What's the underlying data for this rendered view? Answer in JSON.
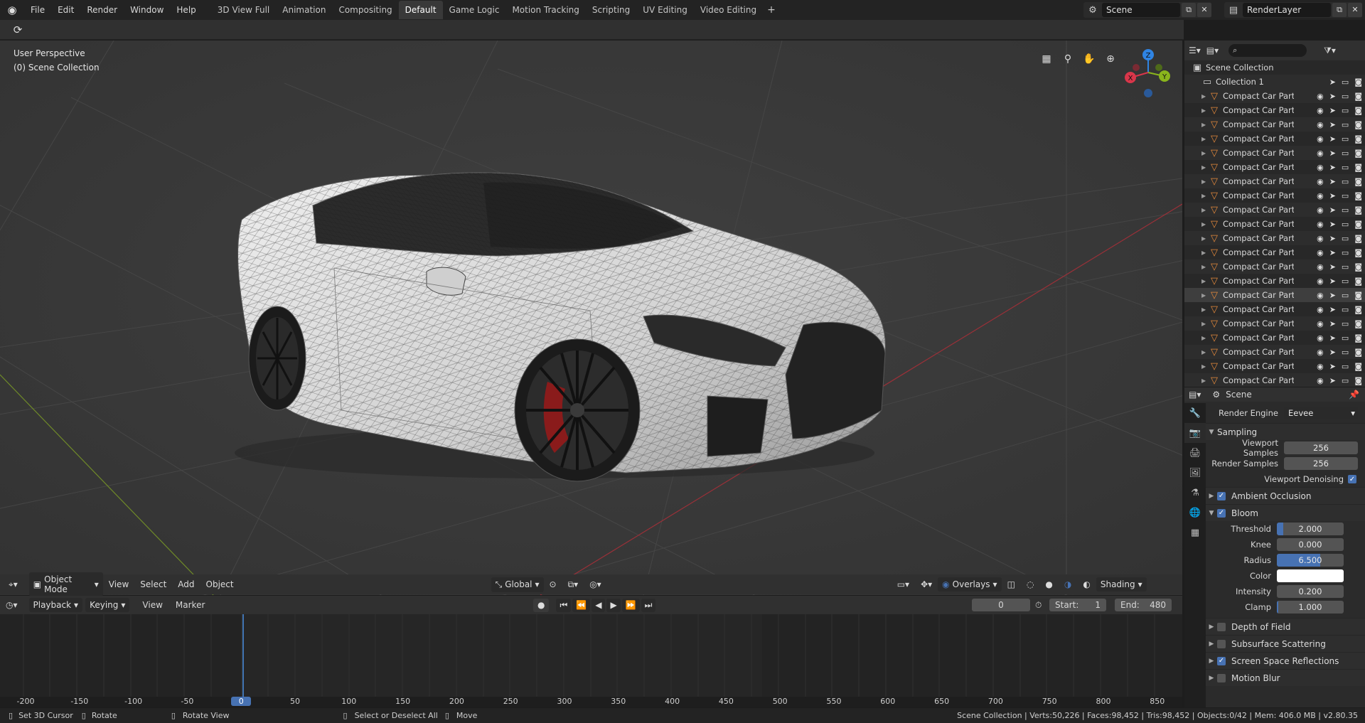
{
  "menus": [
    "File",
    "Edit",
    "Render",
    "Window",
    "Help"
  ],
  "workspaces": [
    "3D View Full",
    "Animation",
    "Compositing",
    "Default",
    "Game Logic",
    "Motion Tracking",
    "Scripting",
    "UV Editing",
    "Video Editing"
  ],
  "active_workspace": "Default",
  "scene_name": "Scene",
  "view_layer": "RenderLayer",
  "viewport": {
    "perspective": "User Perspective",
    "collection": "(0) Scene Collection",
    "mode": "Object Mode",
    "menus": [
      "View",
      "Select",
      "Add",
      "Object"
    ],
    "orientation": "Global",
    "overlays": "Overlays",
    "shading": "Shading",
    "gizmo": {
      "x": "X",
      "y": "Y",
      "z": "Z"
    }
  },
  "timeline": {
    "menus": [
      "Playback",
      "Keying",
      "View",
      "Marker"
    ],
    "current_frame": "0",
    "start_label": "Start:",
    "start": "1",
    "end_label": "End:",
    "end": "480",
    "ruler": [
      "-200",
      "-150",
      "-100",
      "-50",
      "0",
      "50",
      "100",
      "150",
      "200",
      "250",
      "300",
      "350",
      "400",
      "450",
      "500",
      "550",
      "600",
      "650",
      "700",
      "750",
      "800",
      "850"
    ]
  },
  "outliner": {
    "root": "Scene Collection",
    "collection": "Collection 1",
    "items": [
      "Compact Car Part.0",
      "Compact Car Part.0",
      "Compact Car Part.0",
      "Compact Car Part.0",
      "Compact Car Part.0",
      "Compact Car Part.0",
      "Compact Car Part.0",
      "Compact Car Part.0",
      "Compact Car Part.0",
      "Compact Car Part.0",
      "Compact Car Part.0",
      "Compact Car Part.0",
      "Compact Car Part.0",
      "Compact Car Part.0",
      "Compact Car Part.0",
      "Compact Car Part.0",
      "Compact Car Part.0",
      "Compact Car Part.0",
      "Compact Car Part.0",
      "Compact Car Part.0",
      "Compact Car Part.0"
    ],
    "selected_index": 14
  },
  "properties": {
    "title": "Scene",
    "render_engine_label": "Render Engine",
    "render_engine": "Eevee",
    "sampling": "Sampling",
    "viewport_samples_label": "Viewport Samples",
    "viewport_samples": "256",
    "render_samples_label": "Render Samples",
    "render_samples": "256",
    "viewport_denoising": "Viewport Denoising",
    "ambient_occlusion": "Ambient Occlusion",
    "bloom": "Bloom",
    "threshold_label": "Threshold",
    "threshold": "2.000",
    "threshold_fill": 0.1,
    "knee_label": "Knee",
    "knee": "0.000",
    "knee_fill": 0,
    "radius_label": "Radius",
    "radius": "6.500",
    "radius_fill": 0.65,
    "color_label": "Color",
    "intensity_label": "Intensity",
    "intensity": "0.200",
    "intensity_fill": 0,
    "clamp_label": "Clamp",
    "clamp": "1.000",
    "clamp_fill": 0.02,
    "depth_of_field": "Depth of Field",
    "subsurface": "Subsurface Scattering",
    "ssr": "Screen Space Reflections",
    "motion_blur": "Motion Blur"
  },
  "status": {
    "set_cursor": "Set 3D Cursor",
    "rotate": "Rotate",
    "rotate_view": "Rotate View",
    "select": "Select or Deselect All",
    "move": "Move",
    "stats": "Scene Collection | Verts:50,226 | Faces:98,452 | Tris:98,452 | Objects:0/42 | Mem: 406.0 MB | v2.80.35"
  },
  "colors": {
    "accent": "#4772b3",
    "object_icon": "#e68a3c",
    "x_axis": "#d9364a",
    "y_axis": "#8ab51c",
    "z_axis": "#2f84e3"
  }
}
